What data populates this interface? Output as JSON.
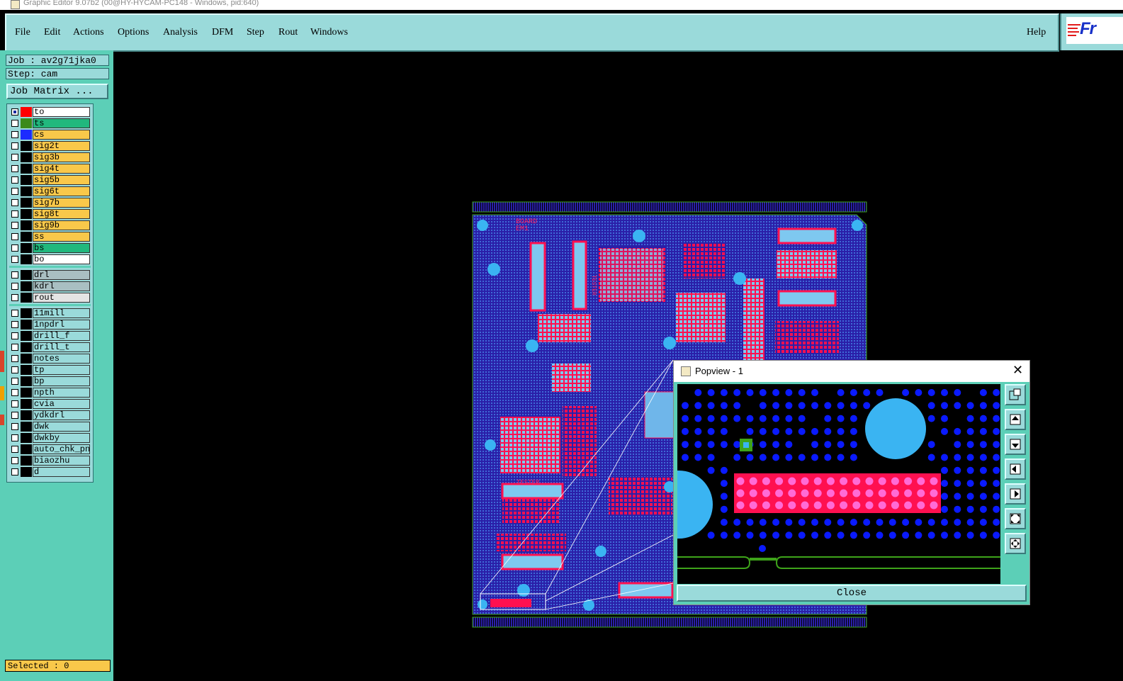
{
  "window": {
    "title": "Graphic Editor 9.07b2 (00@HY-HYCAM-PC148 - Windows, pid:640)"
  },
  "menu": {
    "items": [
      "File",
      "Edit",
      "Actions",
      "Options",
      "Analysis",
      "DFM",
      "Step",
      "Rout",
      "Windows"
    ],
    "help": "Help",
    "logo_text": "Fr"
  },
  "job": {
    "job_label": "Job : av2g71jka0",
    "step_label": "Step: cam",
    "matrix_button": "Job Matrix ..."
  },
  "layers": [
    {
      "name": "to",
      "swatch": "#ff0000",
      "bg": "#ffffff",
      "active": true
    },
    {
      "name": "ts",
      "swatch": "#3b8a1a",
      "bg": "#21b87d"
    },
    {
      "name": "cs",
      "swatch": "#1c2cff",
      "bg": "#f9c84a"
    },
    {
      "name": "sig2t",
      "bg": "#f9c84a"
    },
    {
      "name": "sig3b",
      "bg": "#f9c84a"
    },
    {
      "name": "sig4t",
      "bg": "#f9c84a"
    },
    {
      "name": "sig5b",
      "bg": "#f9c84a"
    },
    {
      "name": "sig6t",
      "bg": "#f9c84a"
    },
    {
      "name": "sig7b",
      "bg": "#f9c84a"
    },
    {
      "name": "sig8t",
      "bg": "#f9c84a"
    },
    {
      "name": "sig9b",
      "bg": "#f9c84a"
    },
    {
      "name": "ss",
      "bg": "#f9c84a"
    },
    {
      "name": "bs",
      "bg": "#21b87d"
    },
    {
      "name": "bo",
      "bg": "#ffffff"
    },
    {
      "name": "drl",
      "bg": "#a9bfc2",
      "group_start": true
    },
    {
      "name": "kdrl",
      "bg": "#a9bfc2"
    },
    {
      "name": "rout",
      "bg": "#e4e4e4"
    },
    {
      "name": "11mill",
      "bg": "#9adada",
      "group_start": true
    },
    {
      "name": "1npdrl",
      "bg": "#9adada"
    },
    {
      "name": "drill_f",
      "bg": "#9adada"
    },
    {
      "name": "drill_t",
      "bg": "#9adada"
    },
    {
      "name": "notes",
      "bg": "#9adada"
    },
    {
      "name": "tp",
      "bg": "#9adada"
    },
    {
      "name": "bp",
      "bg": "#9adada"
    },
    {
      "name": "npth",
      "bg": "#9adada"
    },
    {
      "name": "cvia",
      "bg": "#9adada"
    },
    {
      "name": "ydkdrl",
      "bg": "#9adada"
    },
    {
      "name": "dwk",
      "bg": "#9adada"
    },
    {
      "name": "dwkby",
      "bg": "#9adada"
    },
    {
      "name": "auto_chk_pn",
      "bg": "#9adada"
    },
    {
      "name": "biaozhu",
      "bg": "#9adada"
    },
    {
      "name": "d",
      "bg": "#9adada"
    }
  ],
  "status": {
    "selected": "Selected : 0"
  },
  "board": {
    "labels": [
      "BOARD",
      "EM1",
      "TESTER",
      "TESTER"
    ]
  },
  "popview": {
    "title": "Popview - 1",
    "close_glyph": "✕",
    "close_button": "Close"
  },
  "colors": {
    "menu_bg": "#9adada",
    "panel_bg": "#5ccfb7",
    "board_bg": "#2a1fa8",
    "pad_red": "#ff1050",
    "via_blue": "#0a1aff",
    "hole_cyan": "#3ab4f2",
    "outline_green": "#3ea31a",
    "selected_bg": "#f9c84a"
  },
  "icons": [
    "app-icon",
    "popview-zoom-icon",
    "pan-up-icon",
    "pan-down-icon",
    "pan-left-icon",
    "pan-right-icon",
    "fit-icon",
    "home-icon",
    "close-icon"
  ]
}
